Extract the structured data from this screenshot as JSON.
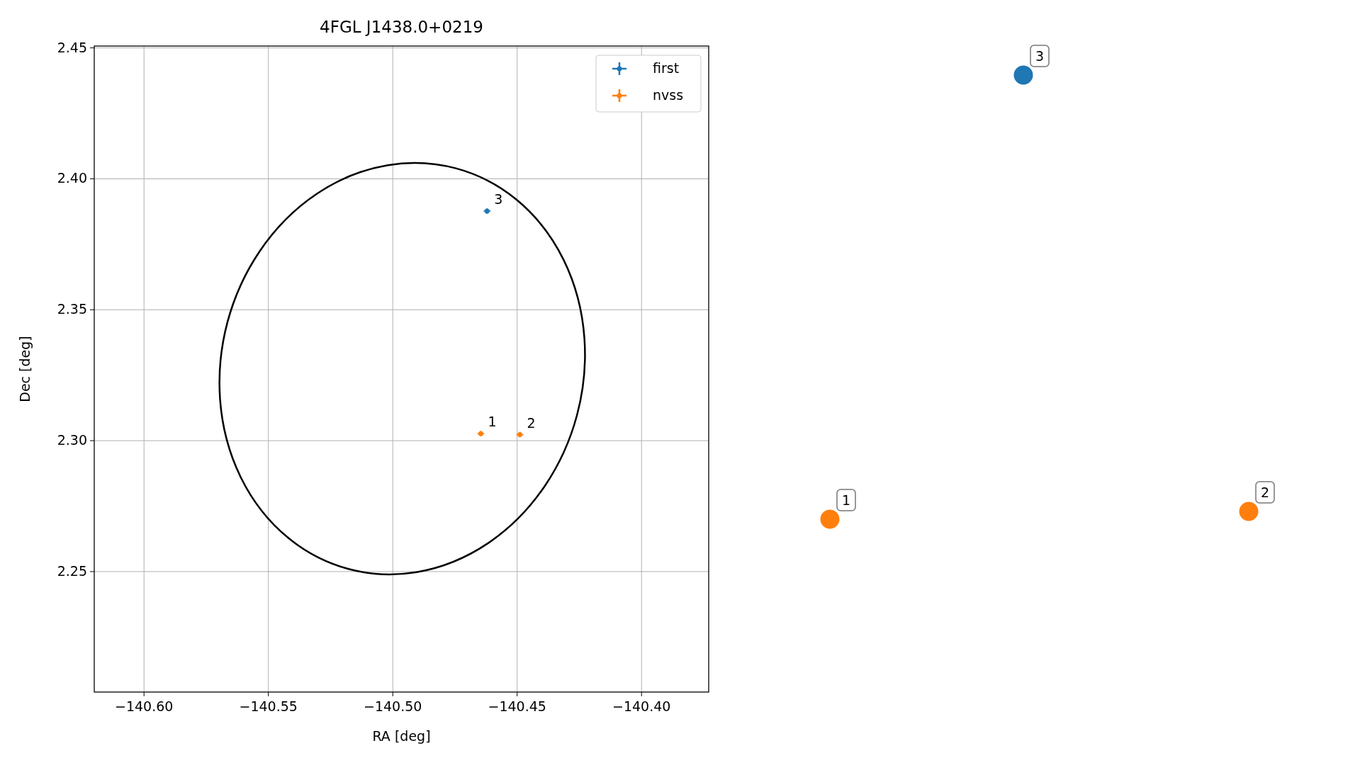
{
  "chart_data": {
    "type": "scatter",
    "title": "4FGL J1438.0+0219",
    "xlabel": "RA [deg]",
    "ylabel": "Dec [deg]",
    "xlim": [
      -140.62,
      -140.373
    ],
    "ylim": [
      2.204,
      2.4507
    ],
    "xticks": [
      {
        "value": -140.6,
        "label": "−140.60"
      },
      {
        "value": -140.55,
        "label": "−140.55"
      },
      {
        "value": -140.5,
        "label": "−140.50"
      },
      {
        "value": -140.45,
        "label": "−140.45"
      },
      {
        "value": -140.4,
        "label": "−140.40"
      }
    ],
    "yticks": [
      {
        "value": 2.25,
        "label": "2.25"
      },
      {
        "value": 2.3,
        "label": "2.30"
      },
      {
        "value": 2.35,
        "label": "2.35"
      },
      {
        "value": 2.4,
        "label": "2.40"
      },
      {
        "value": 2.45,
        "label": "2.45"
      }
    ],
    "series": [
      {
        "name": "first",
        "color": "#1f77b4",
        "x": [
          -140.4621
        ],
        "values": [
          2.3877
        ]
      },
      {
        "name": "nvss",
        "color": "#ff7f0e",
        "x": [
          -140.4646,
          -140.4489
        ],
        "values": [
          2.3027,
          2.3023
        ]
      }
    ],
    "annotations": [
      "1",
      "2",
      "3"
    ],
    "grid": true,
    "legend": true
  },
  "marker_panel": {
    "markers": [
      {
        "label": "1",
        "color": "#ff7f0e"
      },
      {
        "label": "2",
        "color": "#ff7f0e"
      },
      {
        "label": "3",
        "color": "#1f77b4"
      }
    ]
  }
}
